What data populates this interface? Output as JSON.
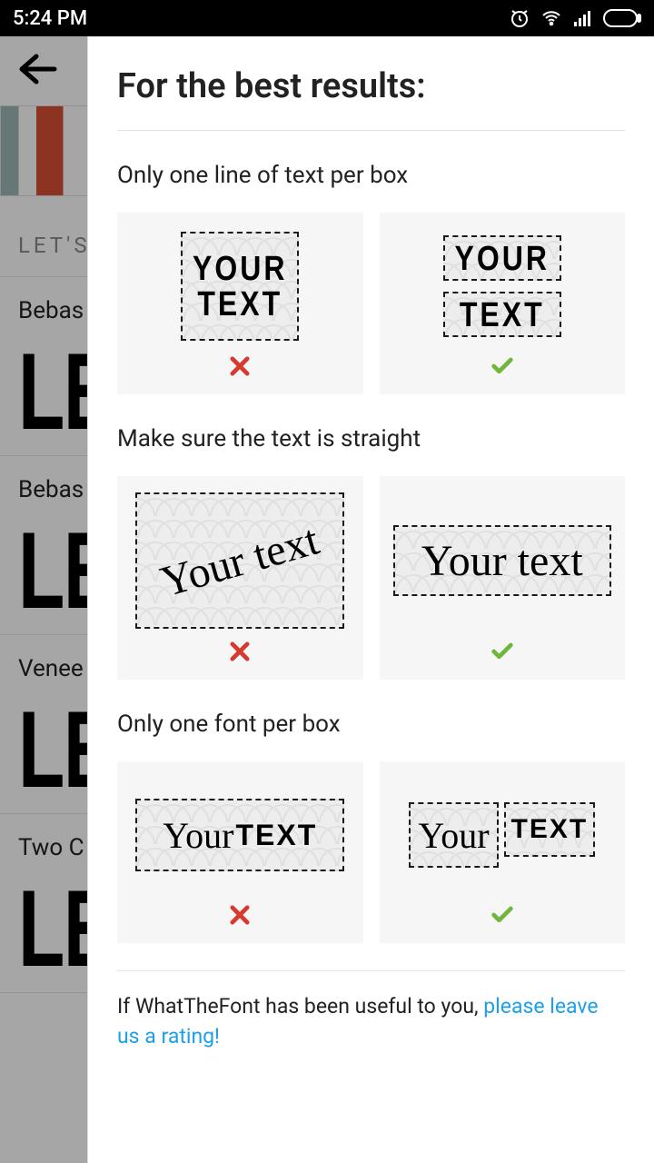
{
  "status": {
    "time": "5:24 PM"
  },
  "background": {
    "section_label": "LET'S",
    "rows": [
      "Bebas",
      "Bebas",
      "Venee",
      "Two C"
    ],
    "preview_text": "LE"
  },
  "sheet": {
    "title": "For the best results:",
    "tips": [
      {
        "title": "Only one line of text per box",
        "wrong_sample_a": "YOUR",
        "wrong_sample_b": "TEXT",
        "right_sample_a": "YOUR",
        "right_sample_b": "TEXT"
      },
      {
        "title": "Make sure the text is straight",
        "wrong_sample": "Your text",
        "right_sample": "Your text"
      },
      {
        "title": "Only one font per box",
        "wrong_sample_a": "Your",
        "wrong_sample_b": "TEXT",
        "right_sample_a": "Your",
        "right_sample_b": "TEXT"
      }
    ],
    "footer_prefix": "If WhatTheFont has been useful to you, ",
    "footer_link": "please leave us a rating!"
  }
}
